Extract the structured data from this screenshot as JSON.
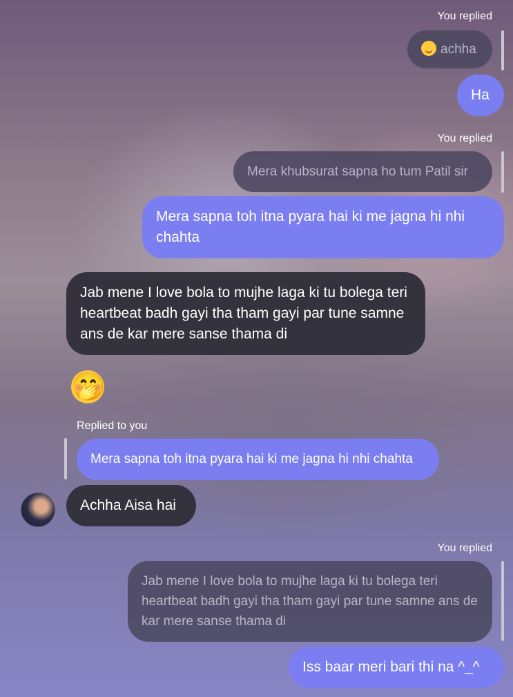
{
  "messages": {
    "reply_1": {
      "label": "You replied",
      "quote": "achha",
      "text": "Ha"
    },
    "reply_2": {
      "label": "You replied",
      "quote": "Mera khubsurat sapna ho tum Patil sir",
      "text": "Mera sapna toh itna pyara hai ki me jagna hi nhi chahta"
    },
    "received_1": "Jab mene I love bola to mujhe laga ki tu bolega teri heartbeat badh gayi tha tham gayi par tune samne ans de kar mere sanse thama di",
    "received_emoji": "🤭",
    "reply_3": {
      "label": "Replied to you",
      "quote": "Mera sapna toh itna pyara hai ki me jagna hi nhi chahta",
      "text": "Achha Aisa hai"
    },
    "reply_4": {
      "label": "You replied",
      "quote": "Jab mene I love bola to mujhe laga ki tu bolega teri heartbeat badh gayi tha tham gayi par tune samne ans de kar mere sanse thama di",
      "text": "Iss baar meri bari thi na ^_^"
    }
  },
  "colors": {
    "sent_bubble": "#7b7ef0",
    "received_bubble": "#34323c",
    "quote_bubble": "#4b4860"
  },
  "icons": {
    "quote_emoji": "grinning-sweat-emoji",
    "received_emoji": "hand-over-mouth-emoji",
    "avatar": "contact-avatar"
  }
}
